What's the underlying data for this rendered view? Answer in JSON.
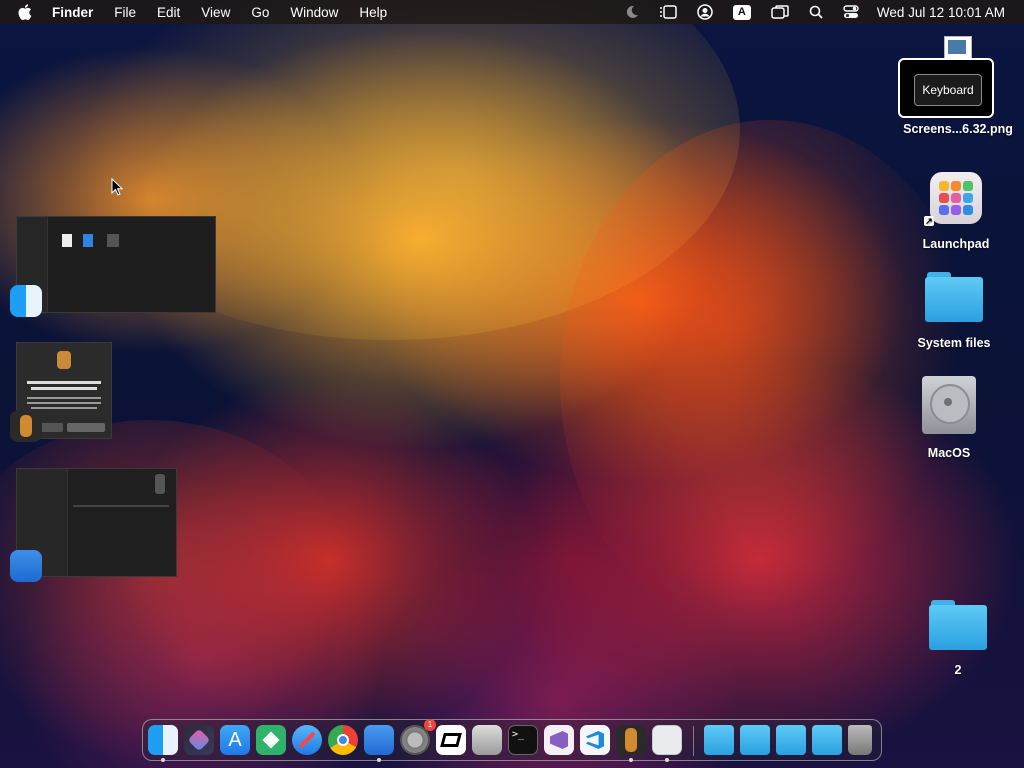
{
  "menubar": {
    "app_name": "Finder",
    "items": [
      "File",
      "Edit",
      "View",
      "Go",
      "Window",
      "Help"
    ],
    "input_badge": "A",
    "clock": "Wed Jul 12  10:01 AM"
  },
  "desktop": {
    "screenshot_label": "Screens...6.32.png",
    "launchpad_label": "Launchpad",
    "system_files_label": "System files",
    "macos_label": "MacOS",
    "folder2_label": "2"
  },
  "keyboard_overlay": {
    "button_label": "Keyboard"
  },
  "dock": {
    "items": [
      "Finder",
      "Shortcuts",
      "App Store",
      "Keystroke",
      "Safari",
      "Chrome",
      "Xcode",
      "System Settings",
      "CapCut",
      "Utilities",
      "Terminal",
      "Visual Studio",
      "VS Code",
      "GarageBand",
      "Preview",
      "Downloads",
      "Documents",
      "Applications",
      "Folder",
      "Trash"
    ],
    "settings_badge": "1"
  },
  "colors": {
    "menubar_bg": "#1e1814",
    "folder_blue": "#3fb2ea"
  }
}
